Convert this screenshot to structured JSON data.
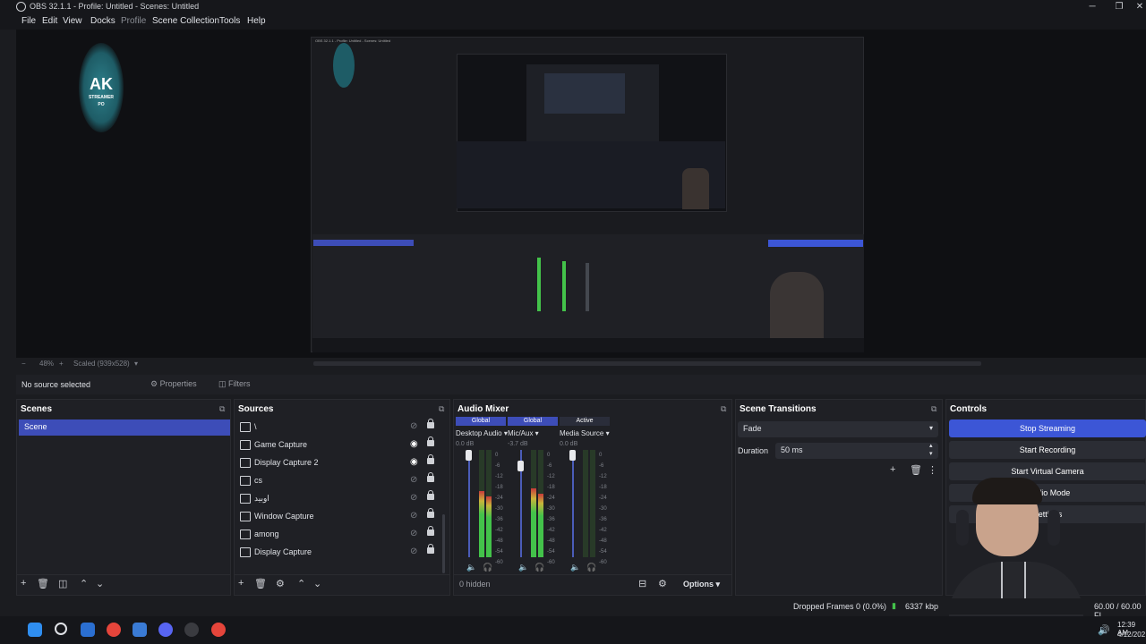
{
  "window": {
    "title": "OBS 32.1.1 - Profile: Untitled - Scenes: Untitled"
  },
  "menu": [
    "File",
    "Edit",
    "View",
    "Docks",
    "Profile",
    "Scene Collection",
    "Tools",
    "Help"
  ],
  "logo": {
    "line1": "AK",
    "line2": "STREAMER",
    "line3": "PO"
  },
  "preview": {
    "zoom": "48%",
    "scale_label": "Scaled (939x528)",
    "nested_title": "OBS 32.1.1 - Profile: Untitled - Scenes: Untitled"
  },
  "context_bar": {
    "selection": "No source selected",
    "properties": "Properties",
    "filters": "Filters"
  },
  "scenes": {
    "title": "Scenes",
    "items": [
      "Scene"
    ]
  },
  "sources": {
    "title": "Sources",
    "items": [
      {
        "label": "\\",
        "icon": "link-icon",
        "visible": false
      },
      {
        "label": "Game Capture",
        "icon": "gamepad-icon",
        "visible": true
      },
      {
        "label": "Display Capture 2",
        "icon": "monitor-icon",
        "visible": true
      },
      {
        "label": "cs",
        "icon": "gamepad-icon",
        "visible": false
      },
      {
        "label": "اوبيد",
        "icon": "link-icon",
        "visible": false
      },
      {
        "label": "Window Capture",
        "icon": "window-icon",
        "visible": false
      },
      {
        "label": "among",
        "icon": "window-icon",
        "visible": false
      },
      {
        "label": "Display Capture",
        "icon": "monitor-icon",
        "visible": false
      }
    ]
  },
  "mixer": {
    "title": "Audio Mixer",
    "channels": [
      {
        "badge": "Global",
        "name": "Desktop Audio",
        "db": "0.0 dB",
        "level": 0.62,
        "badge_color": "#3d4db8"
      },
      {
        "badge": "Global",
        "name": "Mic/Aux",
        "db": "-3.7 dB",
        "level": 0.64,
        "badge_color": "#3d4db8"
      },
      {
        "badge": "Active",
        "name": "Media Source",
        "db": "0.0 dB",
        "level": 0.0,
        "badge_color": "#2a2d3a"
      }
    ],
    "scale": [
      "0",
      "-6",
      "-12",
      "-18",
      "-24",
      "-30",
      "-36",
      "-42",
      "-48",
      "-54",
      "-60"
    ],
    "hidden": "0 hidden",
    "options": "Options"
  },
  "transitions": {
    "title": "Scene Transitions",
    "selected": "Fade",
    "duration_label": "Duration",
    "duration_value": "50 ms"
  },
  "controls": {
    "title": "Controls",
    "buttons": [
      "Stop Streaming",
      "Start Recording",
      "Start Virtual Camera",
      "Studio Mode",
      "Settings"
    ]
  },
  "status": {
    "dropped": "Dropped Frames 0 (0.0%)",
    "bitrate": "6337 kbp",
    "fps": "60.00 / 60.00 FI"
  },
  "taskbar": {
    "time": "12:39 AM",
    "date": "4/12/202"
  },
  "colors": {
    "accent": "#3d4db8",
    "stop_streaming": "#3c56d6",
    "meter_green": "#43c24a",
    "meter_yellow": "#c9b53a",
    "meter_red": "#c83a3a"
  }
}
